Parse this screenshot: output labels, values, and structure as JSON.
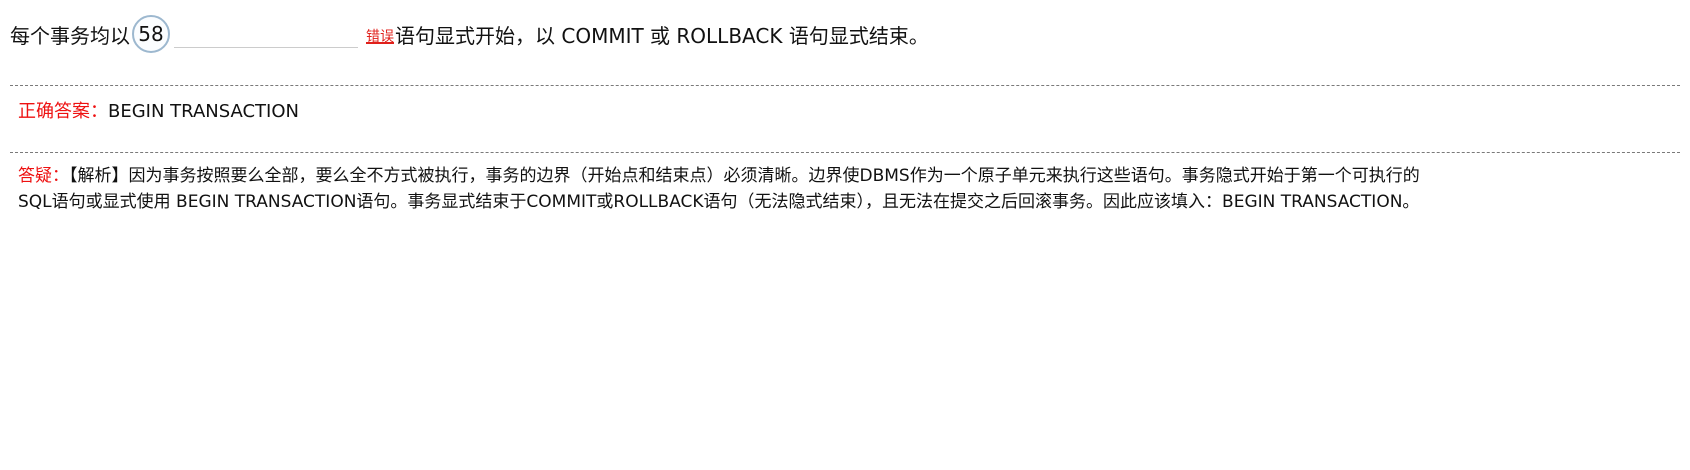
{
  "question": {
    "prefix": "每个事务均以",
    "number": "58",
    "input_value": "",
    "wrong_mark": "错误",
    "suffix": "语句显式开始，以 COMMIT 或 ROLLBACK 语句显式结束。"
  },
  "answer": {
    "label": "正确答案：",
    "value": "BEGIN TRANSACTION"
  },
  "analysis": {
    "label": "答疑：",
    "line1": "【解析】因为事务按照要么全部，要么全不方式被执行，事务的边界（开始点和结束点）必须清晰。边界使DBMS作为一个原子单元来执行这些语句。事务隐式开始于第一个可执行的",
    "line2": "SQL语句或显式使用 BEGIN TRANSACTION语句。事务显式结束于COMMIT或ROLLBACK语句（无法隐式结束），且无法在提交之后回滚事务。因此应该填入：BEGIN TRANSACTION。"
  },
  "colors": {
    "label_red": "#ee1111",
    "wrong_red": "#e0201b",
    "circle_border": "#9db8cf"
  }
}
